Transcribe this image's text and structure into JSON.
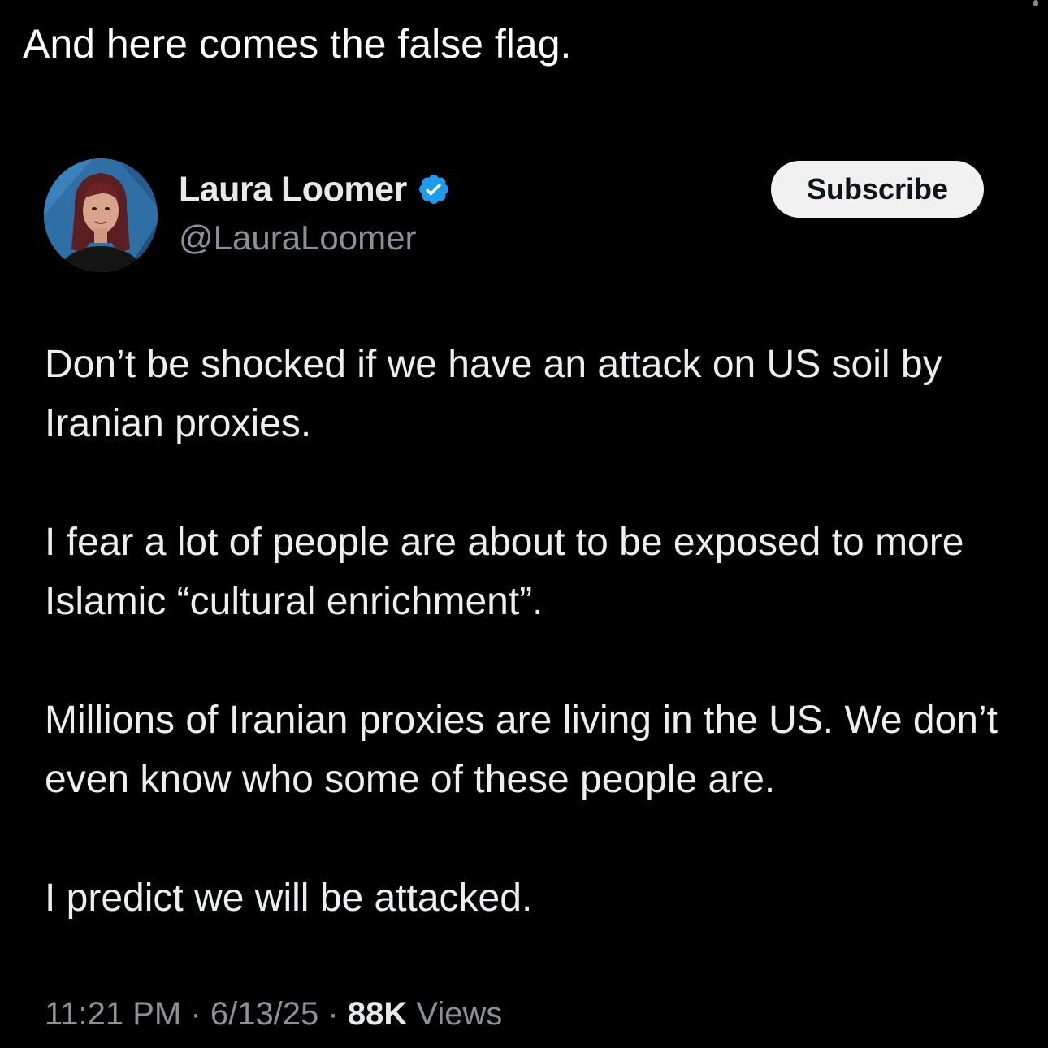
{
  "caption": "And here comes the false flag.",
  "quoted_tweet": {
    "author": {
      "name": "Laura Loomer",
      "handle": "@LauraLoomer",
      "verified_icon": "verified-badge-icon",
      "verified_color": "#1d9bf0"
    },
    "subscribe_label": "Subscribe",
    "paragraphs": [
      "Don’t be shocked if we have an attack on US soil by Iranian proxies.",
      "I fear a lot of people are about to be exposed to more Islamic “cultural enrichment”.",
      "Millions of Iranian proxies are living in the US. We don’t even know who some of these people are.",
      "I predict we will be attacked."
    ],
    "time": "11:21 PM",
    "date": "6/13/25",
    "separator": "·",
    "views_count": "88K",
    "views_label": "Views"
  },
  "colors": {
    "background": "#000000",
    "text": "#e7e9ea",
    "secondary_text": "#8b9198",
    "button_bg": "#f1f1f1"
  }
}
